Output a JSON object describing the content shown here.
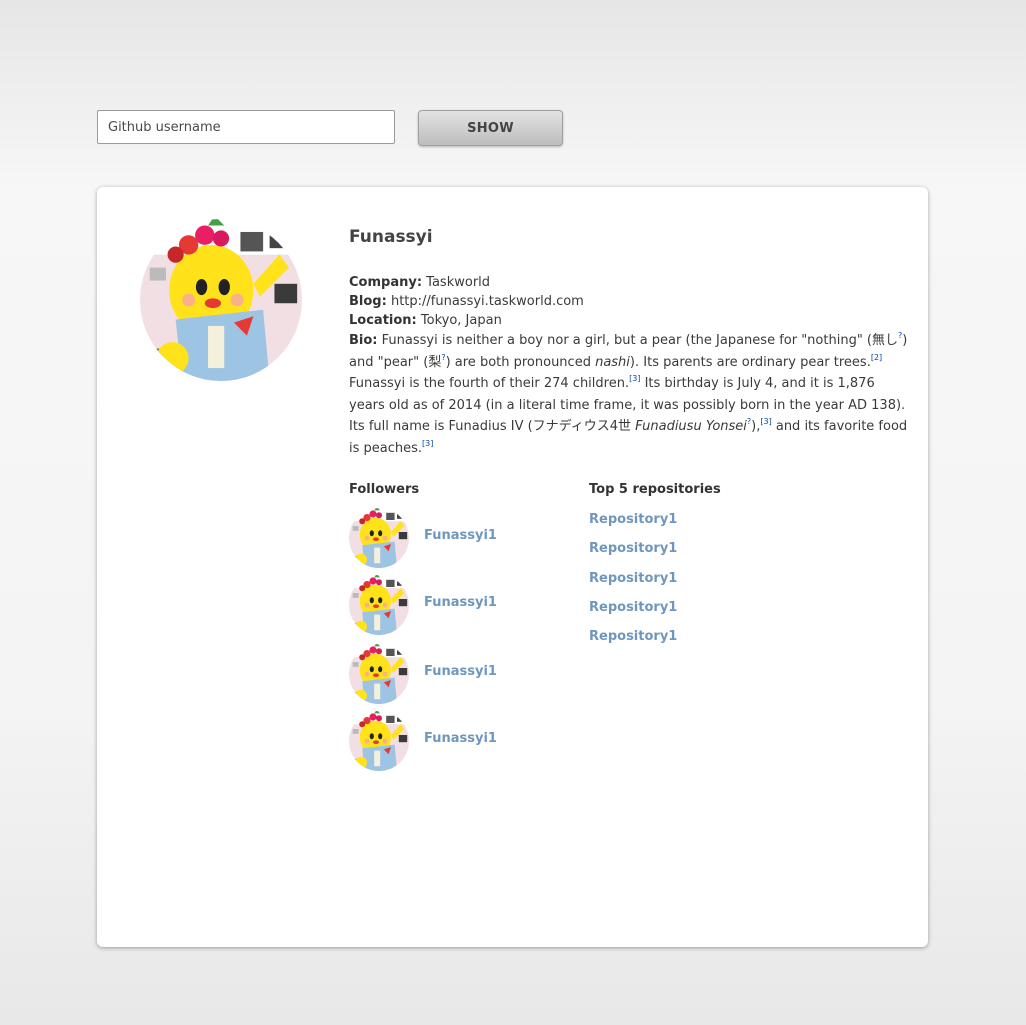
{
  "search": {
    "placeholder": "Github username",
    "button_label": "SHOW"
  },
  "profile": {
    "name": "Funassyi",
    "company_label": "Company:",
    "company": "Taskworld",
    "blog_label": "Blog:",
    "blog": "http://funassyi.taskworld.com",
    "location_label": "Location:",
    "location": "Tokyo, Japan",
    "bio_label": "Bio:",
    "bio": {
      "p1": " Funassyi is neither a boy nor a girl, but a pear (the Japanese for \"nothing\" (無し",
      "q1": "?",
      "p2": ") and \"pear\" (梨",
      "q2": "?",
      "p3": ") are both pronounced ",
      "em1": "nashi",
      "p4": "). Its parents are ordinary pear trees.",
      "ref1": "[2]",
      "p5": " Funassyi is the fourth of their 274 children.",
      "ref2": "[3]",
      "p6": " Its birthday is July 4, and it is 1,876 years old as of 2014 (in a literal time frame, it was possibly born in the year AD 138). Its full name is Funadius IV (フナディウス4世 ",
      "em2": "Funadiusu Yonsei",
      "q3": "?",
      "p7": "),",
      "ref3": "[3]",
      "p8": " and its favorite food is peaches.",
      "ref4": "[3]"
    }
  },
  "followers": {
    "title": "Followers",
    "items": [
      {
        "name": "Funassyi1"
      },
      {
        "name": "Funassyi1"
      },
      {
        "name": "Funassyi1"
      },
      {
        "name": "Funassyi1"
      }
    ]
  },
  "repositories": {
    "title": "Top 5 repositories",
    "items": [
      {
        "name": "Repository1"
      },
      {
        "name": "Repository1"
      },
      {
        "name": "Repository1"
      },
      {
        "name": "Repository1"
      },
      {
        "name": "Repository1"
      }
    ]
  },
  "colors": {
    "link": "#6f97be",
    "card": "#ffffff",
    "text": "#3c3c3c"
  }
}
